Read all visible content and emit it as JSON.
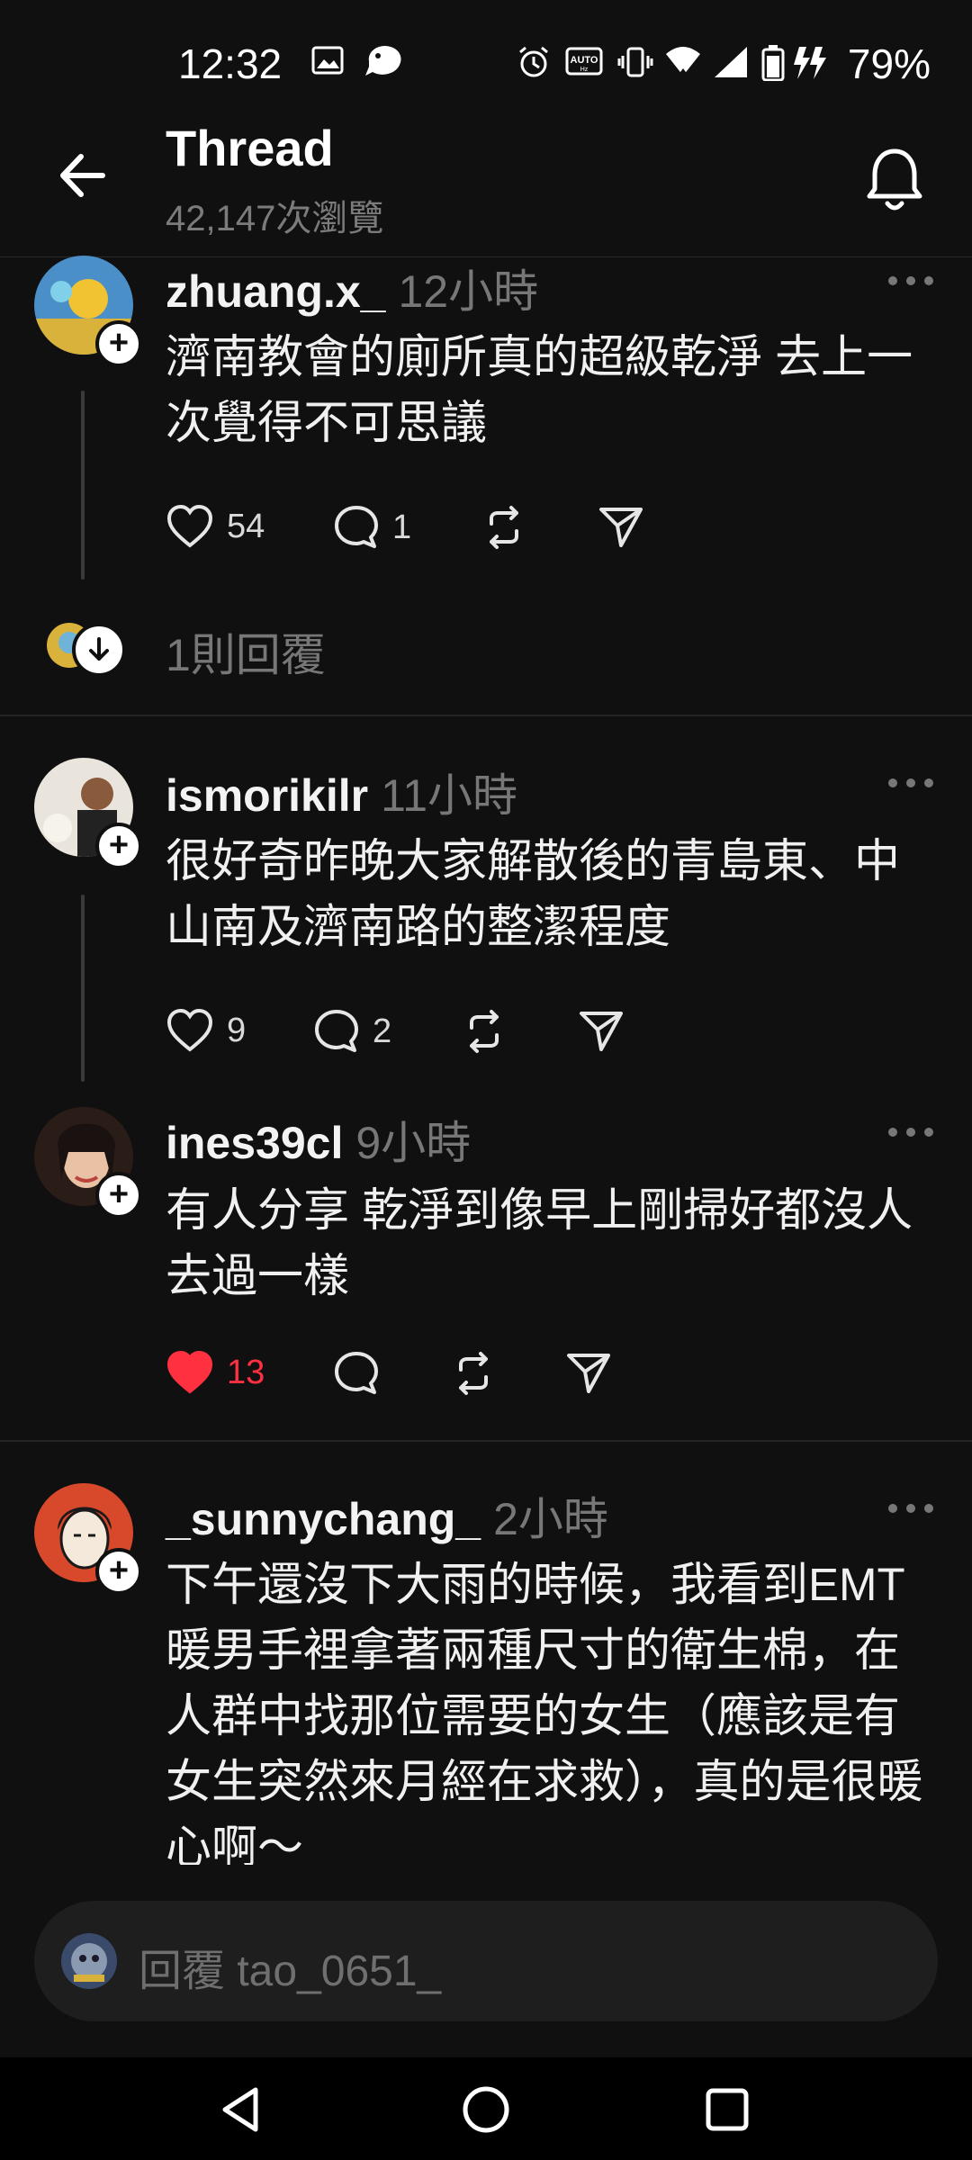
{
  "status_bar": {
    "time": "12:32",
    "battery": "79%",
    "icons": [
      "image-icon",
      "bird-icon",
      "alarm-icon",
      "auto-hz-icon",
      "vibrate-icon",
      "wifi-icon",
      "signal-icon",
      "battery-icon",
      "charging-icon"
    ]
  },
  "header": {
    "title": "Thread",
    "views": "42,147次瀏覽",
    "back_icon": "back-arrow-icon",
    "bell_icon": "bell-icon"
  },
  "posts": [
    {
      "username": "zhuang.x_",
      "time": "12小時",
      "text": "濟南教會的廁所真的超級乾淨 去上一次覺得不可思議",
      "likes": "54",
      "comments": "1",
      "liked": false
    },
    {
      "username": "ismorikilr",
      "time": "11小時",
      "text": "很好奇昨晚大家解散後的青島東、中山南及濟南路的整潔程度",
      "likes": "9",
      "comments": "2",
      "liked": false
    },
    {
      "username": "ines39cl",
      "time": "9小時",
      "text": "有人分享 乾淨到像早上剛掃好都沒人去過一樣",
      "likes": "13",
      "comments": "",
      "liked": true
    },
    {
      "username": "_sunnychang_",
      "time": "2小時",
      "text": "下午還沒下大雨的時候，我看到EMT暖男手裡拿著兩種尺寸的衛生棉，在人群中找那位需要的女生（應該是有女生突然來月經在求救），真的是很暖心啊～",
      "likes": "",
      "comments": "",
      "liked": false
    }
  ],
  "reply_summary": "1則回覆",
  "reply_bar": {
    "placeholder": "回覆 tao_0651_"
  },
  "colors": {
    "background": "#101010",
    "like_red": "#ff3040",
    "secondary_text": "#777777"
  }
}
